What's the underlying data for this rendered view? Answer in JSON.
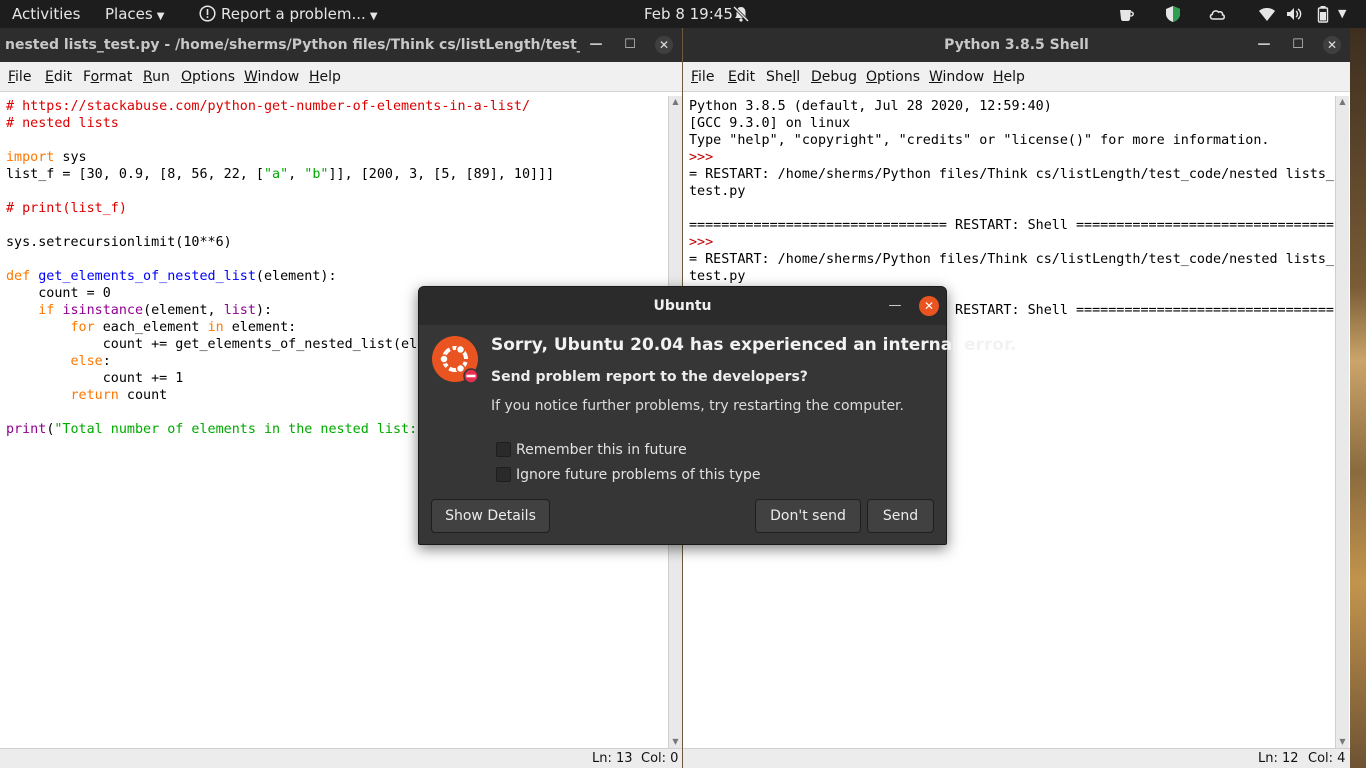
{
  "topbar": {
    "activities": "Activities",
    "places": "Places",
    "report": "Report a problem...",
    "datetime": "Feb 8  19:45"
  },
  "idle_window": {
    "title": "nested lists_test.py - /home/sherms/Python files/Think cs/listLength/test_cod...",
    "menu": [
      "File",
      "Edit",
      "Format",
      "Run",
      "Options",
      "Window",
      "Help"
    ],
    "status_ln": "Ln: 13",
    "status_col": "Col: 0"
  },
  "code_lines": [
    [
      {
        "t": "# https://stackabuse.com/python-get-number-of-elements-in-a-list/",
        "c": "comment"
      }
    ],
    [
      {
        "t": "# nested lists",
        "c": "comment"
      }
    ],
    [
      {
        "t": "",
        "c": ""
      }
    ],
    [
      {
        "t": "import",
        "c": "kw"
      },
      {
        "t": " sys",
        "c": ""
      }
    ],
    [
      {
        "t": "list_f = [30, 0.9, [8, 56, 22, [",
        "c": ""
      },
      {
        "t": "\"a\"",
        "c": "str"
      },
      {
        "t": ", ",
        "c": ""
      },
      {
        "t": "\"b\"",
        "c": "str"
      },
      {
        "t": "]], [200, 3, [5, [89], 10]]]",
        "c": ""
      }
    ],
    [
      {
        "t": "",
        "c": ""
      }
    ],
    [
      {
        "t": "# print(list_f)",
        "c": "comment"
      }
    ],
    [
      {
        "t": "",
        "c": ""
      }
    ],
    [
      {
        "t": "sys.setrecursionlimit(10**6)",
        "c": ""
      }
    ],
    [
      {
        "t": "",
        "c": ""
      }
    ],
    [
      {
        "t": "def",
        "c": "kw"
      },
      {
        "t": " ",
        "c": ""
      },
      {
        "t": "get_elements_of_nested_list",
        "c": "def"
      },
      {
        "t": "(element):",
        "c": ""
      }
    ],
    [
      {
        "t": "    count = 0",
        "c": ""
      }
    ],
    [
      {
        "t": "    ",
        "c": ""
      },
      {
        "t": "if",
        "c": "kw"
      },
      {
        "t": " ",
        "c": ""
      },
      {
        "t": "isinstance",
        "c": "builtin"
      },
      {
        "t": "(element, ",
        "c": ""
      },
      {
        "t": "list",
        "c": "builtin"
      },
      {
        "t": "):",
        "c": ""
      }
    ],
    [
      {
        "t": "        ",
        "c": ""
      },
      {
        "t": "for",
        "c": "kw"
      },
      {
        "t": " each_element ",
        "c": ""
      },
      {
        "t": "in",
        "c": "kw"
      },
      {
        "t": " element:",
        "c": ""
      }
    ],
    [
      {
        "t": "            count += get_elements_of_nested_list(element))",
        "c": ""
      }
    ],
    [
      {
        "t": "        ",
        "c": ""
      },
      {
        "t": "else",
        "c": "kw"
      },
      {
        "t": ":",
        "c": ""
      }
    ],
    [
      {
        "t": "            count += 1",
        "c": ""
      }
    ],
    [
      {
        "t": "        ",
        "c": ""
      },
      {
        "t": "return",
        "c": "kw"
      },
      {
        "t": " count",
        "c": ""
      }
    ],
    [
      {
        "t": "",
        "c": ""
      }
    ],
    [
      {
        "t": "print",
        "c": "builtin"
      },
      {
        "t": "(",
        "c": ""
      },
      {
        "t": "\"Total number of elements in the nested list: \"",
        "c": "str"
      }
    ]
  ],
  "shell_window": {
    "title": "Python 3.8.5 Shell",
    "menu": [
      "File",
      "Edit",
      "Shell",
      "Debug",
      "Options",
      "Window",
      "Help"
    ],
    "status_ln": "Ln: 12",
    "status_col": "Col: 4"
  },
  "shell_lines": [
    [
      {
        "t": "Python 3.8.5 (default, Jul 28 2020, 12:59:40)",
        "c": ""
      }
    ],
    [
      {
        "t": "[GCC 9.3.0] on linux",
        "c": ""
      }
    ],
    [
      {
        "t": "Type \"help\", \"copyright\", \"credits\" or \"license()\" for more information.",
        "c": ""
      }
    ],
    [
      {
        "t": ">>>",
        "c": "prompt"
      }
    ],
    [
      {
        "t": "= RESTART: /home/sherms/Python files/Think cs/listLength/test_code/nested lists_",
        "c": ""
      }
    ],
    [
      {
        "t": "test.py",
        "c": ""
      }
    ],
    [
      {
        "t": "",
        "c": ""
      }
    ],
    [
      {
        "t": "================================ RESTART: Shell ================================",
        "c": ""
      }
    ],
    [
      {
        "t": ">>>",
        "c": "prompt"
      }
    ],
    [
      {
        "t": "= RESTART: /home/sherms/Python files/Think cs/listLength/test_code/nested lists_",
        "c": ""
      }
    ],
    [
      {
        "t": "test.py",
        "c": ""
      }
    ],
    [
      {
        "t": "",
        "c": ""
      }
    ],
    [
      {
        "t": "================================ RESTART: Shell ================================",
        "c": ""
      }
    ]
  ],
  "dialog": {
    "title": "Ubuntu",
    "heading": "Sorry, Ubuntu 20.04 has experienced an internal error.",
    "subheading": "Send problem report to the developers?",
    "text": "If you notice further problems, try restarting the computer.",
    "checkbox_remember": "Remember this in future",
    "checkbox_ignore": "Ignore future problems of this type",
    "checkbox_remember_checked": false,
    "checkbox_ignore_checked": false,
    "btn_details": "Show Details",
    "btn_dont_send": "Don't send",
    "btn_send": "Send"
  },
  "icons": {
    "topbar": [
      "report-problem-icon",
      "bell-disabled-icon",
      "coffee-icon",
      "shield-icon",
      "cloud-icon",
      "wifi-icon",
      "volume-icon",
      "battery-icon",
      "system-menu-chevron-icon"
    ],
    "dialog": [
      "ubuntu-logo-icon",
      "close-icon",
      "minimize-icon"
    ]
  },
  "colors": {
    "ubuntu_orange": "#e95420",
    "idle_comment": "#dd0000",
    "idle_keyword": "#ff7700",
    "idle_builtin": "#900090",
    "idle_def": "#0000ff",
    "idle_string": "#00aa00"
  }
}
